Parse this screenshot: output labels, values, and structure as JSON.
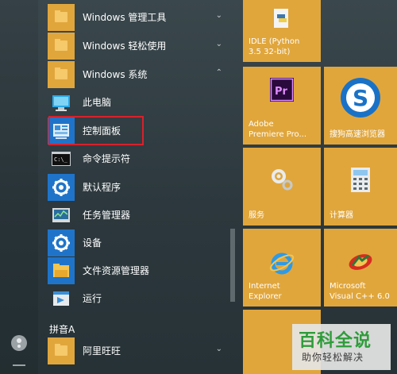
{
  "start_menu": {
    "items": [
      {
        "label": "Windows 管理工具",
        "icon": "folder-icon",
        "chevron": "chevron-down-icon"
      },
      {
        "label": "Windows 轻松使用",
        "icon": "folder-icon",
        "chevron": "chevron-down-icon"
      },
      {
        "label": "Windows 系统",
        "icon": "folder-icon",
        "chevron": "chevron-up-icon",
        "expanded": true
      },
      {
        "label": "此电脑",
        "icon": "computer-icon"
      },
      {
        "label": "控制面板",
        "icon": "control-panel-icon",
        "highlighted": true
      },
      {
        "label": "命令提示符",
        "icon": "command-prompt-icon"
      },
      {
        "label": "默认程序",
        "icon": "gear-icon"
      },
      {
        "label": "任务管理器",
        "icon": "task-manager-icon"
      },
      {
        "label": "设备",
        "icon": "gear-icon"
      },
      {
        "label": "文件资源管理器",
        "icon": "folder-icon"
      },
      {
        "label": "运行",
        "icon": "run-icon"
      }
    ],
    "section_header": "拼音A",
    "after_section": [
      {
        "label": "阿里旺旺",
        "icon": "folder-icon",
        "chevron": "chevron-down-icon"
      }
    ]
  },
  "tiles": [
    {
      "label": "IDLE (Python\n3.5 32-bit)",
      "icon": "python-file-icon"
    },
    {
      "label": "Adobe\nPremiere Pro...",
      "icon": "premiere-icon"
    },
    {
      "label": "搜狗高速浏览器",
      "icon": "sogou-browser-icon"
    },
    {
      "label": "服务",
      "icon": "services-icon"
    },
    {
      "label": "计算器",
      "icon": "calculator-icon"
    },
    {
      "label": "Internet\nExplorer",
      "icon": "ie-icon"
    },
    {
      "label": "Microsoft\nVisual C++ 6.0",
      "icon": "visual-cpp-icon"
    }
  ],
  "chevrons": {
    "down": "⌄",
    "up": "⌃"
  },
  "watermark": {
    "title": "百科全说",
    "subtitle": "助你轻松解决"
  },
  "colors": {
    "accent": "#e0a63c",
    "highlight_border": "#d9212b",
    "icon_blue": "#1f74c9",
    "brand_green": "#2e9c3a"
  }
}
